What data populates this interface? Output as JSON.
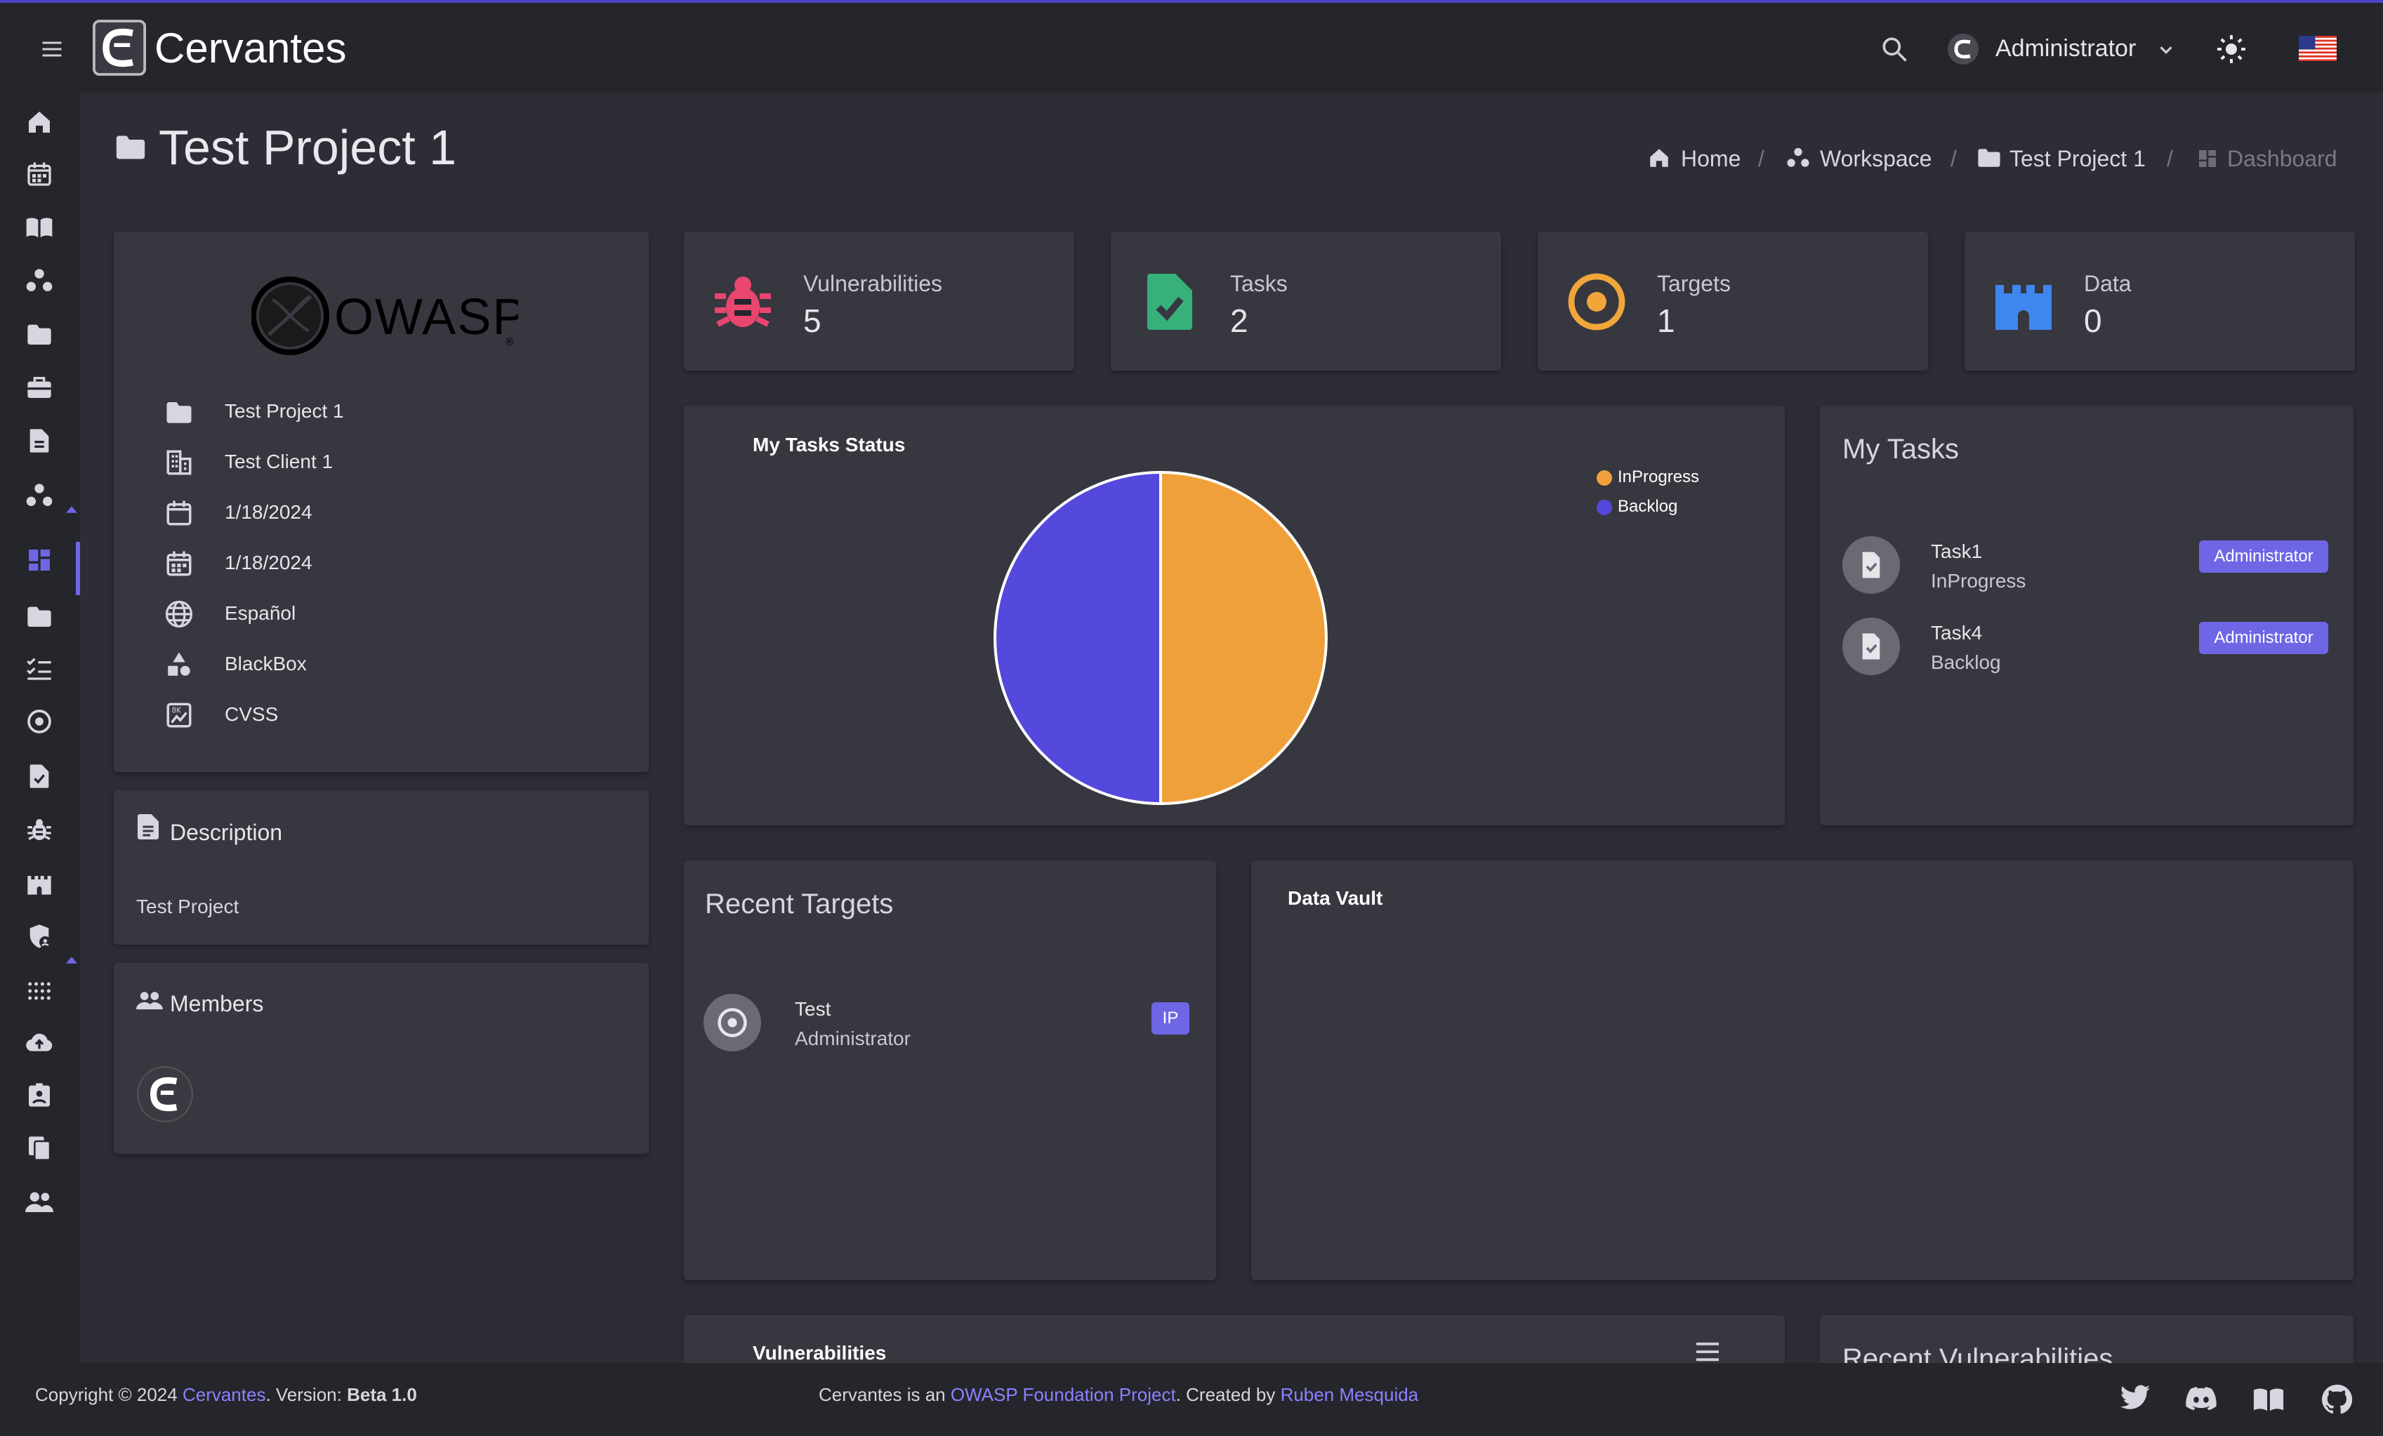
{
  "app": {
    "name": "Cervantes",
    "user": "Administrator"
  },
  "page": {
    "title": "Test Project 1",
    "breadcrumb": [
      "Home",
      "Workspace",
      "Test Project 1",
      "Dashboard"
    ]
  },
  "sidebar": {
    "icons": [
      "home-icon",
      "calendar-icon",
      "book-icon",
      "workspace-icon",
      "folder-icon",
      "briefcase-icon",
      "document-icon",
      "workspace-icon",
      "dashboard-icon",
      "folder-icon",
      "checklist-icon",
      "target-icon",
      "task-icon",
      "bug-icon",
      "castle-icon",
      "shield-icon",
      "grid-icon",
      "cloud-upload-icon",
      "badge-icon",
      "copy-icon",
      "users-icon"
    ],
    "active_index": 8
  },
  "project": {
    "logo_text": "OWASP",
    "details": [
      {
        "icon": "folder-icon",
        "value": "Test Project 1"
      },
      {
        "icon": "building-icon",
        "value": "Test Client 1"
      },
      {
        "icon": "calendar-blank-icon",
        "value": "1/18/2024"
      },
      {
        "icon": "calendar-icon",
        "value": "1/18/2024"
      },
      {
        "icon": "globe-icon",
        "value": "Español"
      },
      {
        "icon": "shapes-icon",
        "value": "BlackBox"
      },
      {
        "icon": "score-icon",
        "value": "CVSS"
      }
    ],
    "description_title": "Description",
    "description": "Test Project",
    "members_title": "Members"
  },
  "stats": [
    {
      "label": "Vulnerabilities",
      "value": "5",
      "color": "#e8456f",
      "icon": "bug-icon"
    },
    {
      "label": "Tasks",
      "value": "2",
      "color": "#37b07a",
      "icon": "task-file-icon"
    },
    {
      "label": "Targets",
      "value": "1",
      "color": "#f0a63a",
      "icon": "target-icon"
    },
    {
      "label": "Data",
      "value": "0",
      "color": "#3f86f0",
      "icon": "castle-icon"
    }
  ],
  "chart_data": {
    "type": "pie",
    "title": "My Tasks Status",
    "categories": [
      "InProgress",
      "Backlog"
    ],
    "values": [
      1,
      1
    ],
    "colors": [
      "#f0a03a",
      "#5548dc"
    ],
    "legend": "top-right"
  },
  "my_tasks": {
    "title": "My Tasks",
    "items": [
      {
        "name": "Task1",
        "status": "InProgress",
        "assignee": "Administrator"
      },
      {
        "name": "Task4",
        "status": "Backlog",
        "assignee": "Administrator"
      }
    ]
  },
  "recent_targets": {
    "title": "Recent Targets",
    "items": [
      {
        "name": "Test",
        "owner": "Administrator",
        "type": "IP"
      }
    ]
  },
  "data_vault": {
    "title": "Data Vault"
  },
  "vulns_chart": {
    "title": "Vulnerabilities"
  },
  "recent_vulns": {
    "title": "Recent Vulnerabilities"
  },
  "footer": {
    "copyright": "Copyright © 2024",
    "app_link": "Cervantes",
    "version_label": ". Version: ",
    "version": "Beta 1.0",
    "middle_prefix": "Cervantes is an ",
    "owasp_link": "OWASP Foundation Project",
    "created_by": ". Created by ",
    "author_link": "Ruben Mesquida"
  },
  "colors": {
    "accent": "#6f66e6",
    "background": "#2d2d36",
    "bar": "#25252c",
    "card": "#373740"
  }
}
